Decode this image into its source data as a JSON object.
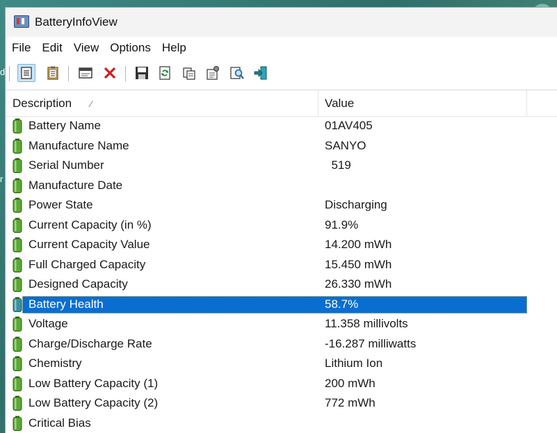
{
  "window": {
    "title": "BatteryInfoView"
  },
  "menu": [
    "File",
    "Edit",
    "View",
    "Options",
    "Help"
  ],
  "toolbar": [
    {
      "name": "view-mode-list-button",
      "icon": "list-view-icon"
    },
    {
      "name": "view-mode-clipboard-button",
      "icon": "clipboard-view-icon"
    },
    {
      "name": "properties-window-button",
      "icon": "window-icon"
    },
    {
      "name": "delete-button",
      "icon": "red-x-icon"
    },
    {
      "name": "save-button",
      "icon": "floppy-disk-icon"
    },
    {
      "name": "refresh-button",
      "icon": "refresh-icon"
    },
    {
      "name": "copy-button",
      "icon": "copy-icon"
    },
    {
      "name": "properties-button",
      "icon": "properties-icon"
    },
    {
      "name": "find-button",
      "icon": "find-icon"
    },
    {
      "name": "exit-button",
      "icon": "exit-icon"
    }
  ],
  "columns": {
    "description": "Description",
    "value": "Value"
  },
  "rows": [
    {
      "label": "Battery Name",
      "value": "01AV405"
    },
    {
      "label": "Manufacture Name",
      "value": "SANYO"
    },
    {
      "label": "Serial Number",
      "value": "  519"
    },
    {
      "label": "Manufacture Date",
      "value": ""
    },
    {
      "label": "Power State",
      "value": "Discharging"
    },
    {
      "label": "Current Capacity (in %)",
      "value": "91.9%"
    },
    {
      "label": "Current Capacity Value",
      "value": "14.200 mWh"
    },
    {
      "label": "Full Charged Capacity",
      "value": "15.450 mWh"
    },
    {
      "label": "Designed Capacity",
      "value": "26.330 mWh"
    },
    {
      "label": "Battery Health",
      "value": "58.7%",
      "selected": true
    },
    {
      "label": "Voltage",
      "value": "11.358 millivolts"
    },
    {
      "label": "Charge/Discharge Rate",
      "value": "-16.287 milliwatts"
    },
    {
      "label": "Chemistry",
      "value": "Lithium Ion"
    },
    {
      "label": "Low Battery Capacity (1)",
      "value": "200 mWh"
    },
    {
      "label": "Low Battery Capacity (2)",
      "value": "772 mWh"
    },
    {
      "label": "Critical Bias",
      "value": ""
    }
  ],
  "colors": {
    "selection": "#0a6ed1",
    "battery_green": "#5aa832",
    "battery_selected": "#3a8fa0"
  }
}
